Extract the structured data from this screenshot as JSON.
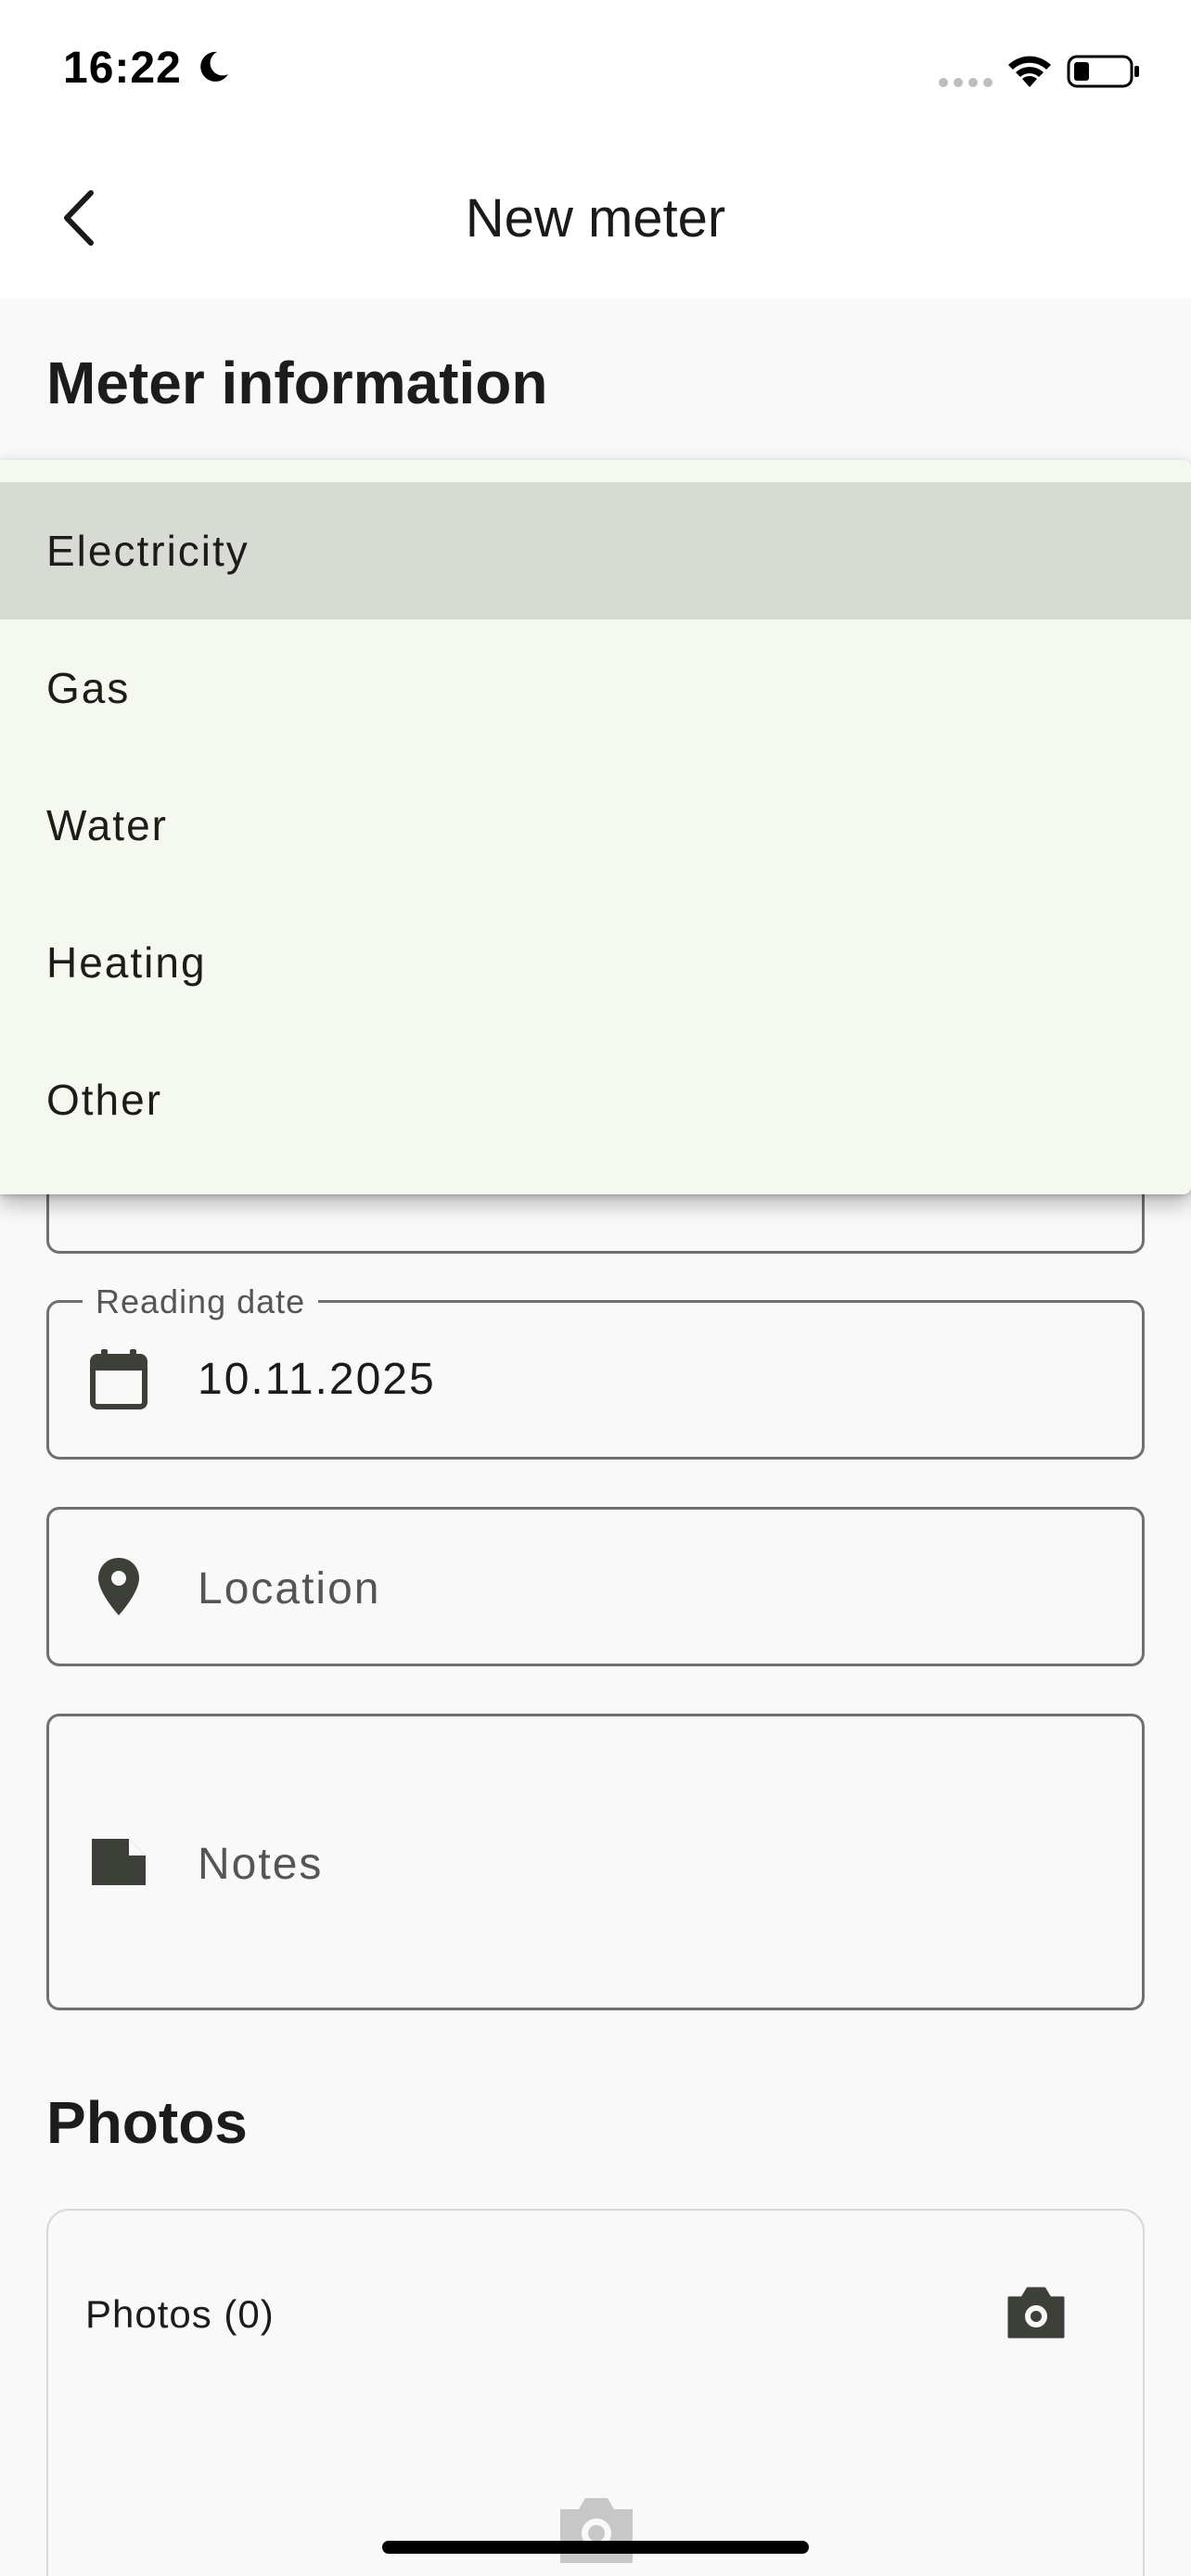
{
  "status_bar": {
    "time": "16:22",
    "icons": [
      "moon-icon",
      "signal-dots",
      "wifi-icon",
      "battery-icon"
    ]
  },
  "app_bar": {
    "title": "New meter",
    "back_icon": "chevron-left-icon"
  },
  "sections": {
    "meter_information": "Meter information",
    "photos": "Photos"
  },
  "dropdown": {
    "options": [
      "Electricity",
      "Gas",
      "Water",
      "Heating",
      "Other"
    ],
    "highlighted": "Electricity"
  },
  "fields": {
    "reading_date": {
      "label": "Reading date",
      "value": "10.11.2025",
      "icon": "calendar-icon"
    },
    "location": {
      "placeholder": "Location",
      "icon": "location-pin-icon"
    },
    "notes": {
      "placeholder": "Notes",
      "icon": "note-icon"
    }
  },
  "photos": {
    "count_label": "Photos (0)",
    "add_icon": "camera-icon"
  },
  "colors": {
    "background": "#f9f9f9",
    "menu_background": "#f5f8ef",
    "menu_highlight": "#d8dbd4",
    "icon": "#3c4039",
    "outline": "#707070"
  }
}
